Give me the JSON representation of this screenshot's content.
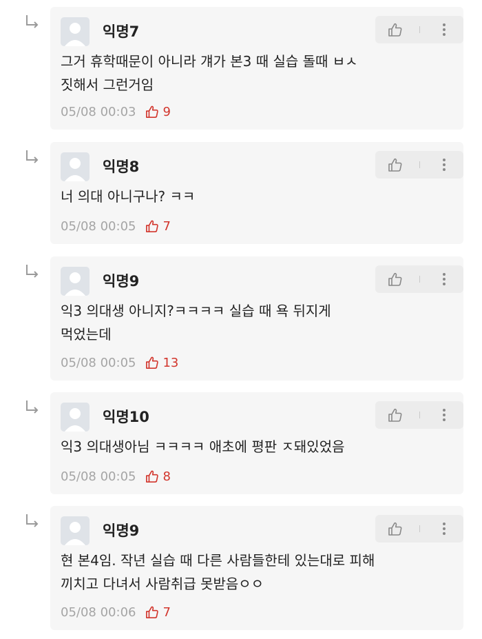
{
  "comments": [
    {
      "nick": "익명7",
      "content": "그거 휴학때문이 아니라 걔가 본3 때 실습 돌때 ㅂㅅ\n짓해서 그런거임",
      "time": "05/08 00:03",
      "likes": "9"
    },
    {
      "nick": "익명8",
      "content": "너 의대 아니구나? ㅋㅋ",
      "time": "05/08 00:05",
      "likes": "7"
    },
    {
      "nick": "익명9",
      "content": "익3 의대생 아니지?ㅋㅋㅋㅋ 실습 때 욕 뒤지게\n먹었는데",
      "time": "05/08 00:05",
      "likes": "13"
    },
    {
      "nick": "익명10",
      "content": "익3 의대생아님 ㅋㅋㅋㅋ 애초에 평판 ㅈ돼있었음",
      "time": "05/08 00:05",
      "likes": "8"
    },
    {
      "nick": "익명9",
      "content": "현 본4임. 작년 실습 때 다른 사람들한테 있는대로 피해\n끼치고 다녀서 사람취급 못받음ㅇㅇ",
      "time": "05/08 00:06",
      "likes": "7"
    }
  ],
  "icons": {
    "reply": "reply-arrow-icon",
    "like": "thumbs-up-icon",
    "more": "more-vertical-icon"
  },
  "colors": {
    "card_bg": "#f6f6f6",
    "like_red": "#d2352c",
    "meta_gray": "#a5a5a5"
  }
}
